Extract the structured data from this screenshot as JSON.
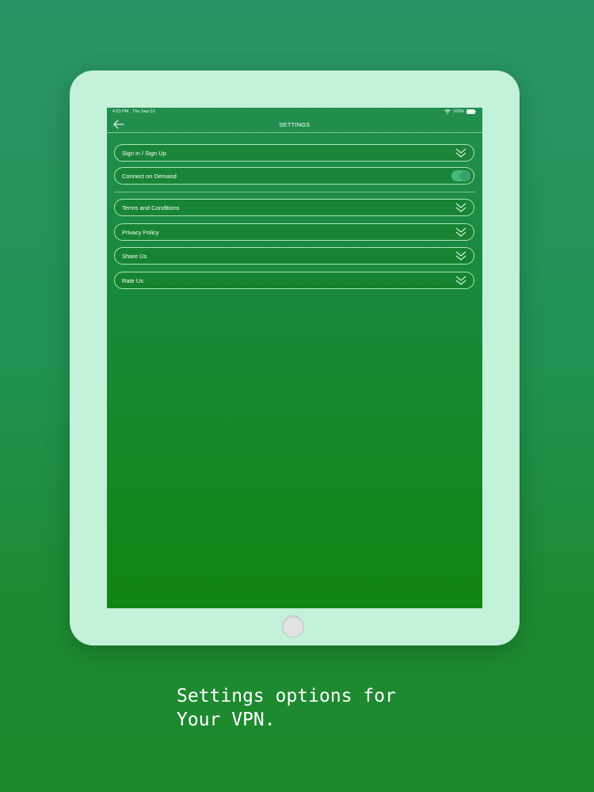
{
  "status_bar": {
    "time": "4:53 PM",
    "date": "Thu Sep 10",
    "battery": "100%"
  },
  "nav": {
    "title": "SETTINGS"
  },
  "rows": [
    {
      "label": "Sign in / Sign Up"
    },
    {
      "label": "Connect on Demand",
      "toggle_on": true
    },
    {
      "label": "Terms and Conditions"
    },
    {
      "label": "Privacy Policy"
    },
    {
      "label": "Share Us"
    },
    {
      "label": "Rate Us"
    }
  ],
  "caption": {
    "line1": "Settings options for",
    "line2": "Your VPN."
  },
  "icons": {
    "back": "arrow-left-icon",
    "expand": "double-chevron-down-icon",
    "wifi": "wifi-icon",
    "battery": "battery-icon"
  },
  "colors": {
    "background": "#219253",
    "device_frame": "#c3f1d9",
    "screen": "#18893a",
    "toggle_track": "#47b882"
  }
}
